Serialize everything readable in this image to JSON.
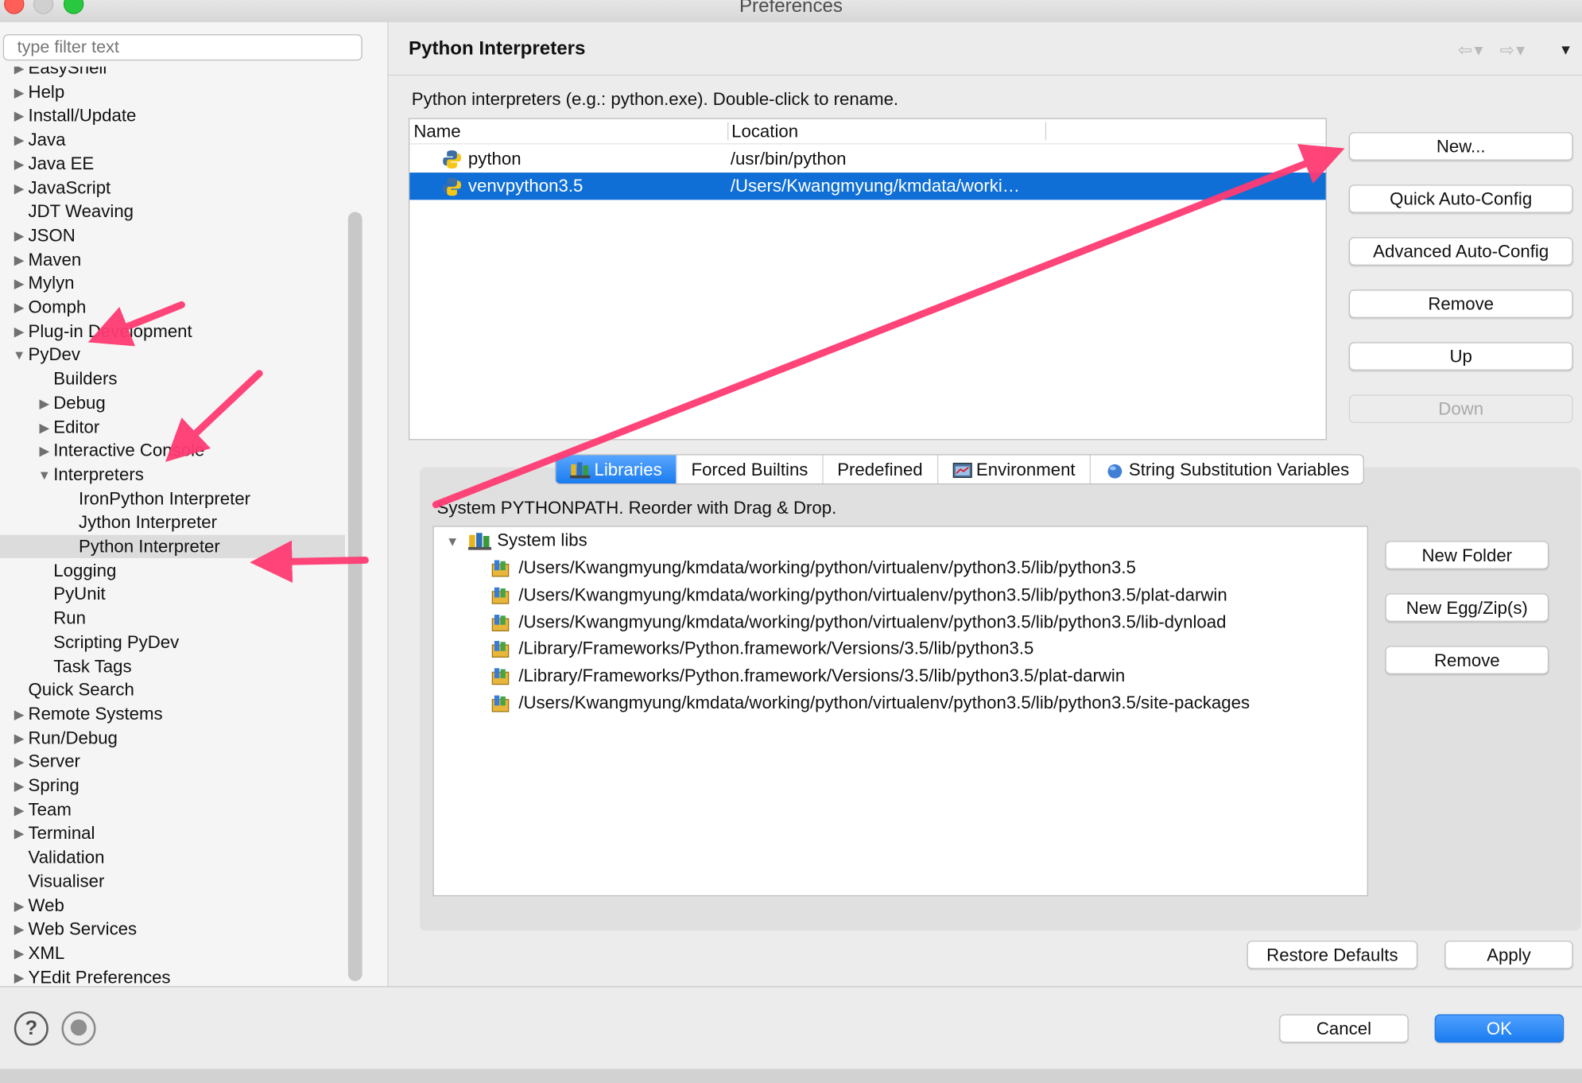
{
  "window": {
    "title": "Preferences"
  },
  "filter": {
    "placeholder": "type filter text"
  },
  "tree": [
    {
      "label": "EasyShell",
      "indent": 0,
      "toggle": "collapsed",
      "partial": true
    },
    {
      "label": "Help",
      "indent": 0,
      "toggle": "collapsed"
    },
    {
      "label": "Install/Update",
      "indent": 0,
      "toggle": "collapsed"
    },
    {
      "label": "Java",
      "indent": 0,
      "toggle": "collapsed"
    },
    {
      "label": "Java EE",
      "indent": 0,
      "toggle": "collapsed"
    },
    {
      "label": "JavaScript",
      "indent": 0,
      "toggle": "collapsed"
    },
    {
      "label": "JDT Weaving",
      "indent": 0,
      "toggle": "none"
    },
    {
      "label": "JSON",
      "indent": 0,
      "toggle": "collapsed"
    },
    {
      "label": "Maven",
      "indent": 0,
      "toggle": "collapsed"
    },
    {
      "label": "Mylyn",
      "indent": 0,
      "toggle": "collapsed"
    },
    {
      "label": "Oomph",
      "indent": 0,
      "toggle": "collapsed"
    },
    {
      "label": "Plug-in Development",
      "indent": 0,
      "toggle": "collapsed"
    },
    {
      "label": "PyDev",
      "indent": 0,
      "toggle": "expanded"
    },
    {
      "label": "Builders",
      "indent": 1,
      "toggle": "none"
    },
    {
      "label": "Debug",
      "indent": 1,
      "toggle": "collapsed"
    },
    {
      "label": "Editor",
      "indent": 1,
      "toggle": "collapsed"
    },
    {
      "label": "Interactive Console",
      "indent": 1,
      "toggle": "collapsed"
    },
    {
      "label": "Interpreters",
      "indent": 1,
      "toggle": "expanded"
    },
    {
      "label": "IronPython Interpreter",
      "indent": 2,
      "toggle": "none"
    },
    {
      "label": "Jython Interpreter",
      "indent": 2,
      "toggle": "none"
    },
    {
      "label": "Python Interpreter",
      "indent": 2,
      "toggle": "none",
      "selected": true
    },
    {
      "label": "Logging",
      "indent": 1,
      "toggle": "none"
    },
    {
      "label": "PyUnit",
      "indent": 1,
      "toggle": "none"
    },
    {
      "label": "Run",
      "indent": 1,
      "toggle": "none"
    },
    {
      "label": "Scripting PyDev",
      "indent": 1,
      "toggle": "none"
    },
    {
      "label": "Task Tags",
      "indent": 1,
      "toggle": "none"
    },
    {
      "label": "Quick Search",
      "indent": 0,
      "toggle": "none"
    },
    {
      "label": "Remote Systems",
      "indent": 0,
      "toggle": "collapsed"
    },
    {
      "label": "Run/Debug",
      "indent": 0,
      "toggle": "collapsed"
    },
    {
      "label": "Server",
      "indent": 0,
      "toggle": "collapsed"
    },
    {
      "label": "Spring",
      "indent": 0,
      "toggle": "collapsed"
    },
    {
      "label": "Team",
      "indent": 0,
      "toggle": "collapsed"
    },
    {
      "label": "Terminal",
      "indent": 0,
      "toggle": "collapsed"
    },
    {
      "label": "Validation",
      "indent": 0,
      "toggle": "none"
    },
    {
      "label": "Visualiser",
      "indent": 0,
      "toggle": "none"
    },
    {
      "label": "Web",
      "indent": 0,
      "toggle": "collapsed"
    },
    {
      "label": "Web Services",
      "indent": 0,
      "toggle": "collapsed"
    },
    {
      "label": "XML",
      "indent": 0,
      "toggle": "collapsed"
    },
    {
      "label": "YEdit Preferences",
      "indent": 0,
      "toggle": "collapsed"
    }
  ],
  "page": {
    "title": "Python Interpreters",
    "nav_icons": [
      "back-icon",
      "forward-icon",
      "menu-icon"
    ],
    "description": "Python interpreters (e.g.: python.exe).   Double-click to rename.",
    "columns": [
      "Name",
      "Location"
    ],
    "interpreters": [
      {
        "name": "python",
        "location": "/usr/bin/python",
        "selected": false
      },
      {
        "name": "venvpython3.5",
        "location": "/Users/Kwangmyung/kmdata/worki…",
        "selected": true
      }
    ],
    "buttons": [
      "New...",
      "Quick Auto-Config",
      "Advanced Auto-Config",
      "Remove",
      "Up",
      "Down"
    ],
    "tabs": [
      "Libraries",
      "Forced Builtins",
      "Predefined",
      "Environment",
      "String Substitution Variables"
    ],
    "active_tab": "Libraries",
    "libs_description": "System PYTHONPATH.   Reorder with Drag & Drop.",
    "libs_root": "System libs",
    "libs": [
      "/Users/Kwangmyung/kmdata/working/python/virtualenv/python3.5/lib/python3.5",
      "/Users/Kwangmyung/kmdata/working/python/virtualenv/python3.5/lib/python3.5/plat-darwin",
      "/Users/Kwangmyung/kmdata/working/python/virtualenv/python3.5/lib/python3.5/lib-dynload",
      "/Library/Frameworks/Python.framework/Versions/3.5/lib/python3.5",
      "/Library/Frameworks/Python.framework/Versions/3.5/lib/python3.5/plat-darwin",
      "/Users/Kwangmyung/kmdata/working/python/virtualenv/python3.5/lib/python3.5/site-packages"
    ],
    "lib_buttons": [
      "New Folder",
      "New Egg/Zip(s)",
      "Remove"
    ],
    "restore_defaults": "Restore Defaults",
    "apply": "Apply"
  },
  "footer": {
    "cancel": "Cancel",
    "ok": "OK",
    "help_icon": "help-icon",
    "record_icon": "record-icon"
  },
  "colors": {
    "selection": "#0f6fd6",
    "annotation_arrow": "#ff3b73",
    "ok_button": "#1a7cf0"
  }
}
